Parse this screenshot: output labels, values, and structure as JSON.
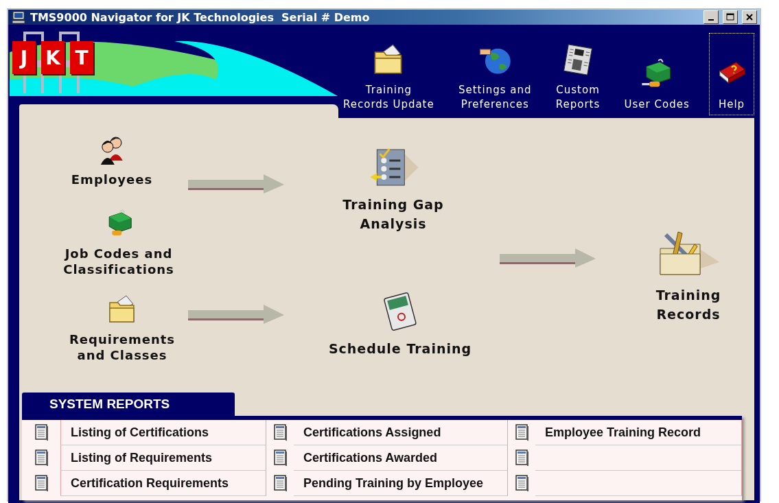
{
  "window": {
    "title": "TMS9000 Navigator for JK Technologies  Serial # Demo"
  },
  "logo": {
    "letters": [
      "J",
      "K",
      "T"
    ]
  },
  "toolbar": [
    {
      "kind": "folder",
      "lines": [
        "Training",
        "Records Update"
      ],
      "focused": false
    },
    {
      "kind": "globe",
      "lines": [
        "Settings and",
        "Preferences"
      ],
      "focused": false
    },
    {
      "kind": "newspaper",
      "lines": [
        "Custom",
        "Reports"
      ],
      "focused": false
    },
    {
      "kind": "toolbox",
      "lines": [
        "User Codes"
      ],
      "focused": false
    },
    {
      "kind": "book",
      "lines": [
        "Help"
      ],
      "focused": true
    }
  ],
  "workflow": {
    "nodes": [
      {
        "kind": "people",
        "lines": [
          "Employees"
        ]
      },
      {
        "kind": "toolbox",
        "lines": [
          "Job Codes and",
          "Classifications"
        ]
      },
      {
        "kind": "folder",
        "lines": [
          "Requirements",
          "and Classes"
        ]
      },
      {
        "kind": "checklist",
        "lines": [
          "Training Gap",
          "Analysis"
        ]
      },
      {
        "kind": "planner",
        "lines": [
          "Schedule Training"
        ]
      },
      {
        "kind": "tools",
        "lines": [
          "Training",
          "Records"
        ]
      }
    ]
  },
  "system_reports": {
    "title": "SYSTEM REPORTS",
    "rows": [
      [
        "Listing of Certifications",
        "Certifications Assigned",
        "Employee Training Record"
      ],
      [
        "Listing of Requirements",
        "Certifications Awarded",
        null
      ],
      [
        "Certification Requirements",
        "Pending Training by Employee",
        null
      ]
    ]
  }
}
